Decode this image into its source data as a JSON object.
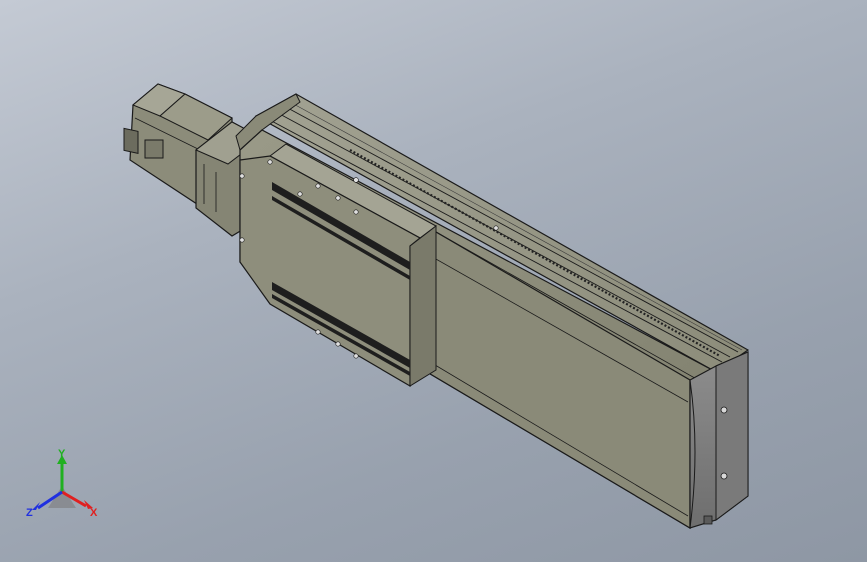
{
  "scene": {
    "model_icon": "linear-actuator-module",
    "background_colors": [
      "#c4cad4",
      "#8e97a4"
    ],
    "body_color": "#8a8a78",
    "edge_color": "#1a1a1a"
  },
  "triad": {
    "x_label": "X",
    "y_label": "Y",
    "z_label": "Z",
    "x_color": "#e02020",
    "y_color": "#20b020",
    "z_color": "#2030e0"
  }
}
